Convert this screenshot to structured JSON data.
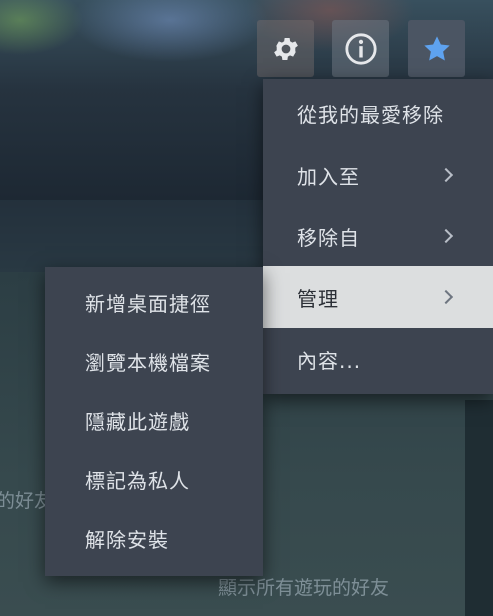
{
  "background": {
    "friends_partial_text": "的好友",
    "friends_all_text": "顯示所有遊玩的好友"
  },
  "toolbar": {
    "settings_icon": "gear-icon",
    "info_icon": "info-icon",
    "favorite_icon": "star-icon",
    "favorite_color": "#5ea2ef"
  },
  "context_menu": {
    "items": [
      {
        "label": "從我的最愛移除",
        "has_submenu": false
      },
      {
        "label": "加入至",
        "has_submenu": true
      },
      {
        "label": "移除自",
        "has_submenu": true
      },
      {
        "label": "管理",
        "has_submenu": true,
        "active": true
      },
      {
        "label": "內容...",
        "has_submenu": false
      }
    ]
  },
  "manage_submenu": {
    "items": [
      {
        "label": "新增桌面捷徑"
      },
      {
        "label": "瀏覽本機檔案"
      },
      {
        "label": "隱藏此遊戲"
      },
      {
        "label": "標記為私人"
      },
      {
        "label": "解除安裝"
      }
    ]
  }
}
